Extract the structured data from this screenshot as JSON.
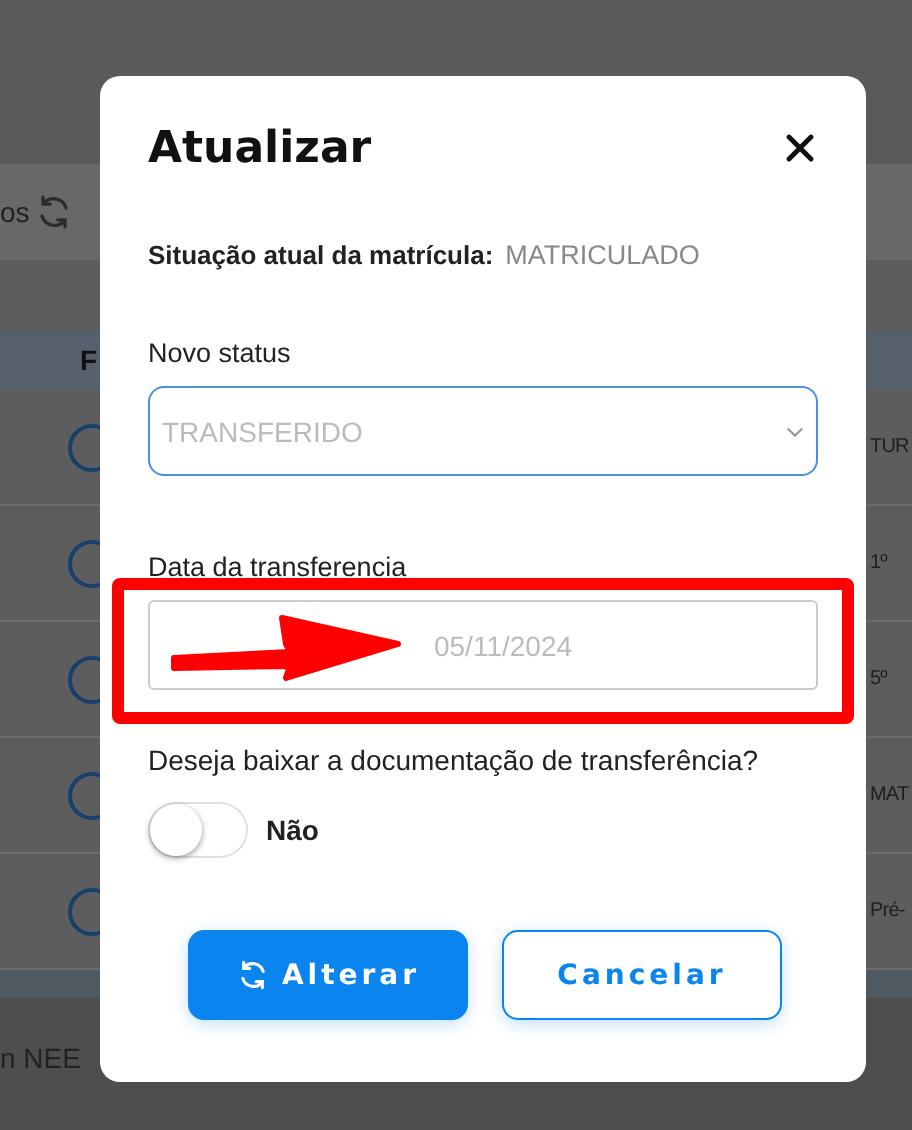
{
  "background": {
    "toolbar_text": "os",
    "table_header": "F",
    "rows": [
      {
        "end_text": "TUR"
      },
      {
        "end_text": "1º"
      },
      {
        "end_text": "5º"
      },
      {
        "end_text": "MAT"
      },
      {
        "end_text": "Pré-"
      }
    ],
    "footer_text": "n NEE"
  },
  "dialog": {
    "title": "Atualizar",
    "current_status": {
      "label": "Situação atual da matrícula:",
      "value": "MATRICULADO"
    },
    "new_status": {
      "label": "Novo status",
      "value": "TRANSFERIDO",
      "disabled": true
    },
    "transfer_date": {
      "label": "Data da transferencia",
      "value": "05/11/2024",
      "disabled": true
    },
    "question": "Deseja baixar a documentação de transferência?",
    "toggle": {
      "on": false,
      "label": "Não"
    },
    "buttons": [
      {
        "kind": "primary",
        "label": "Alterar"
      },
      {
        "kind": "secondary",
        "label": "Cancelar"
      }
    ]
  }
}
